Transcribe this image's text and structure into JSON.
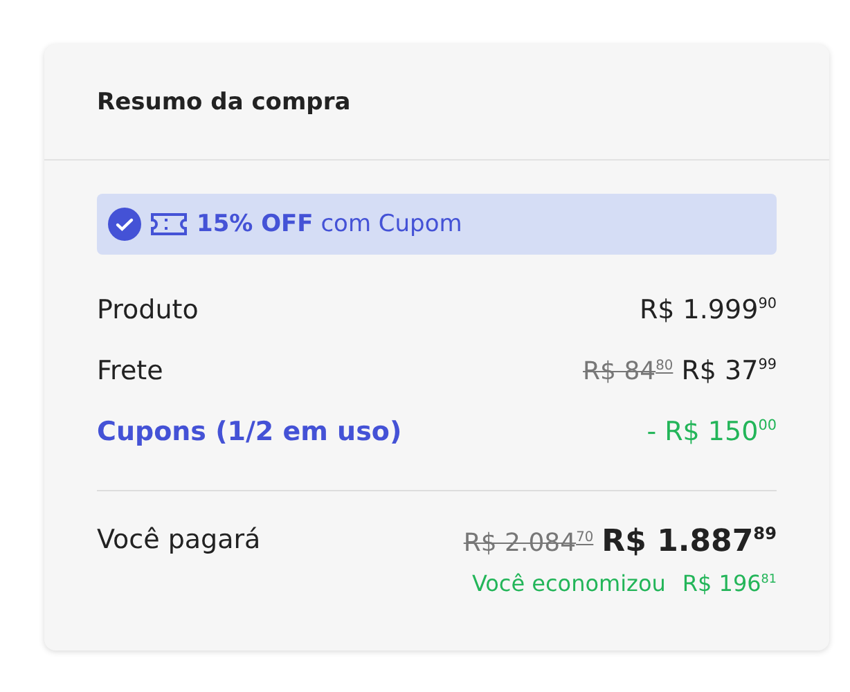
{
  "title": "Resumo da compra",
  "banner": {
    "highlight": "15% OFF",
    "text": "com Cupom",
    "checked": true
  },
  "rows": [
    {
      "kind": "item",
      "label": "Produto",
      "price": "R$ 1.999$^{90}$"
    },
    {
      "kind": "item",
      "label": "Frete",
      "old_price": "R$ 84$^{80}$",
      "price": "R$ 37$^{99}$"
    },
    {
      "kind": "discount",
      "label": "Cupons (1/2 em uso)",
      "price": "- R$ 150$^{00}$"
    }
  ],
  "total": {
    "label": "Você pagará",
    "old_price": "R$ 2.084$^{70}$",
    "price": "R$ 1.887$^{89}$",
    "savings_label": "Você economizou",
    "savings": "R$ 196$^{81}$"
  }
}
